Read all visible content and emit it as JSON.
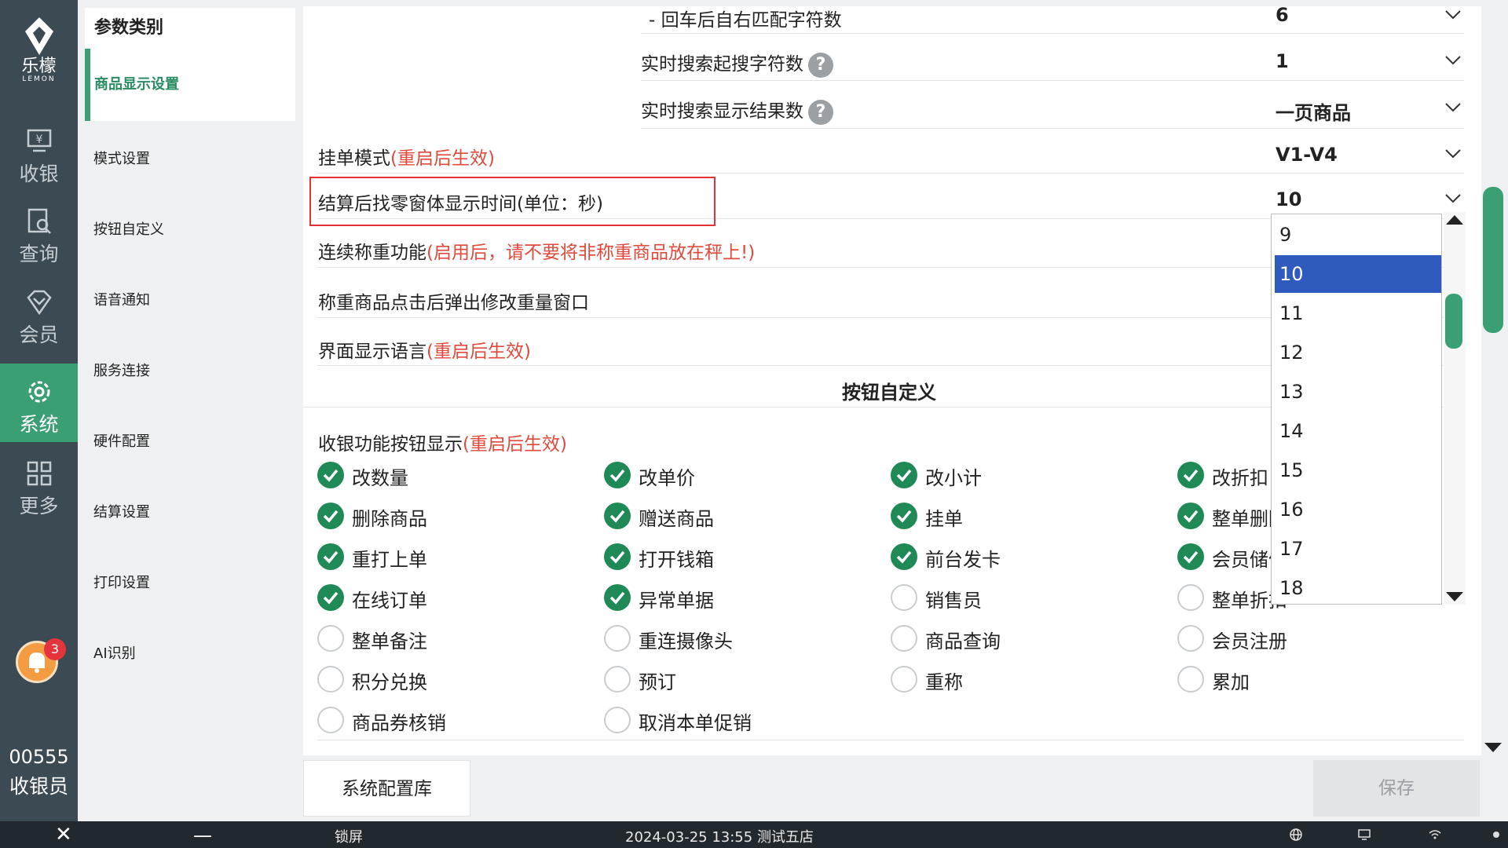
{
  "rail": {
    "logo_cn": "乐檬",
    "logo_en": "LEMON",
    "nav": [
      {
        "label": "收银",
        "icon": "cash-register-icon"
      },
      {
        "label": "查询",
        "icon": "query-icon"
      },
      {
        "label": "会员",
        "icon": "member-diamond-icon"
      },
      {
        "label": "系统",
        "icon": "gear-icon"
      },
      {
        "label": "更多",
        "icon": "grid-icon"
      }
    ],
    "notification_count": "3",
    "user_id": "00555",
    "user_role": "收银员"
  },
  "categories": {
    "header": "参数类别",
    "active": "商品显示设置",
    "items": [
      "模式设置",
      "按钮自定义",
      "语音通知",
      "服务连接",
      "硬件配置",
      "结算设置",
      "打印设置",
      "AI识别"
    ]
  },
  "settings": {
    "row1": {
      "label": "- 回车后自右匹配字符数",
      "value": "6"
    },
    "row2": {
      "label": "实时搜索起搜字符数",
      "value": "1"
    },
    "row3": {
      "label": "实时搜索显示结果数",
      "value": "一页商品"
    },
    "row4": {
      "label": "挂单模式",
      "note": "(重启后生效)",
      "value": "V1-V4"
    },
    "row5": {
      "label": "结算后找零窗体显示时间(单位：秒)",
      "value": "10"
    },
    "row6": {
      "label": "连续称重功能",
      "note": "(启用后，请不要将非称重商品放在秤上!)"
    },
    "row7": {
      "label": "称重商品点击后弹出修改重量窗口"
    },
    "row8": {
      "label": "界面显示语言",
      "note": "(重启后生效)"
    }
  },
  "section_title": "按钮自定义",
  "buttons_display": {
    "label": "收银功能按钮显示",
    "note": "(重启后生效)",
    "options": [
      {
        "label": "改数量",
        "checked": true
      },
      {
        "label": "改单价",
        "checked": true
      },
      {
        "label": "改小计",
        "checked": true
      },
      {
        "label": "改折扣",
        "checked": true
      },
      {
        "label": "删除商品",
        "checked": true
      },
      {
        "label": "赠送商品",
        "checked": true
      },
      {
        "label": "挂单",
        "checked": true
      },
      {
        "label": "整单删除",
        "checked": true
      },
      {
        "label": "重打上单",
        "checked": true
      },
      {
        "label": "打开钱箱",
        "checked": true
      },
      {
        "label": "前台发卡",
        "checked": true
      },
      {
        "label": "会员储值",
        "checked": true
      },
      {
        "label": "在线订单",
        "checked": true
      },
      {
        "label": "异常单据",
        "checked": true
      },
      {
        "label": "销售员",
        "checked": false
      },
      {
        "label": "整单折扣",
        "checked": false
      },
      {
        "label": "整单备注",
        "checked": false
      },
      {
        "label": "重连摄像头",
        "checked": false
      },
      {
        "label": "商品查询",
        "checked": false
      },
      {
        "label": "会员注册",
        "checked": false
      },
      {
        "label": "积分兑换",
        "checked": false
      },
      {
        "label": "预订",
        "checked": false
      },
      {
        "label": "重称",
        "checked": false
      },
      {
        "label": "累加",
        "checked": false
      },
      {
        "label": "商品券核销",
        "checked": false
      },
      {
        "label": "取消本单促销",
        "checked": false
      }
    ]
  },
  "dropdown": {
    "options": [
      "9",
      "10",
      "11",
      "12",
      "13",
      "14",
      "15",
      "16",
      "17",
      "18"
    ],
    "selected": "10"
  },
  "footer": {
    "system_config_label": "系统配置库",
    "save_label": "保存"
  },
  "statusbar": {
    "lock_label": "锁屏",
    "datetime": "2024-03-25 13:55",
    "store": "测试五店"
  },
  "colors": {
    "accent": "#3b9f74",
    "rail": "#3c4a53",
    "warning": "#e04a3c",
    "selection": "#2f5bbf"
  }
}
